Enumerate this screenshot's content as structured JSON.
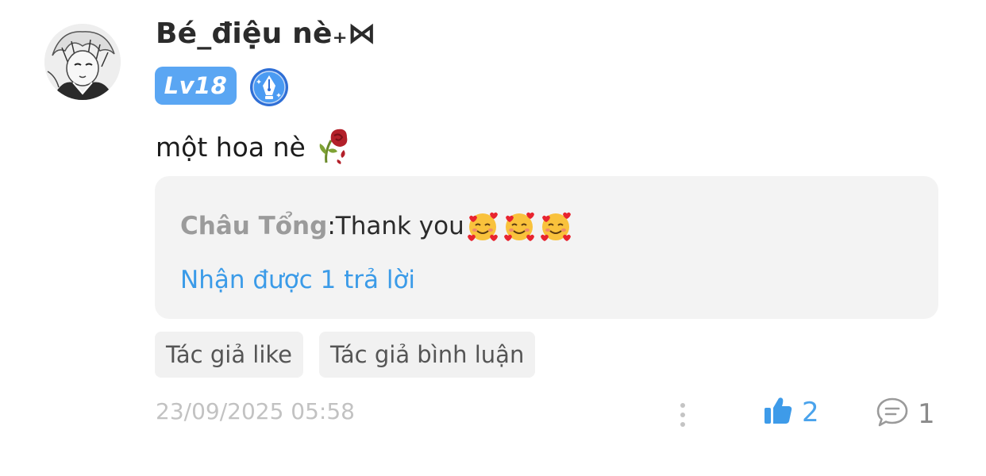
{
  "comment": {
    "username": "Bé_điệu nè₊⋈",
    "level": "Lv18",
    "badge_icon": "fountain-pen-badge-icon",
    "text": "một hoa nè",
    "content_emoji": "wilted-rose-icon",
    "reply_preview": {
      "author": "Châu Tổng",
      "separator": ":",
      "text": " Thank you",
      "emoji": "smiling-face-with-hearts-icon"
    },
    "replies_link": "Nhận được 1 trả lời",
    "tags": [
      "Tác giả like",
      "Tác giả bình luận"
    ],
    "timestamp": "23/09/2025 05:58",
    "like_count": "2",
    "comment_count": "1"
  },
  "colors": {
    "accent_blue": "#3b9be8",
    "level_badge": "#5aa6f3",
    "muted_gray": "#c2c2c2",
    "reply_bg": "#f3f3f3"
  }
}
